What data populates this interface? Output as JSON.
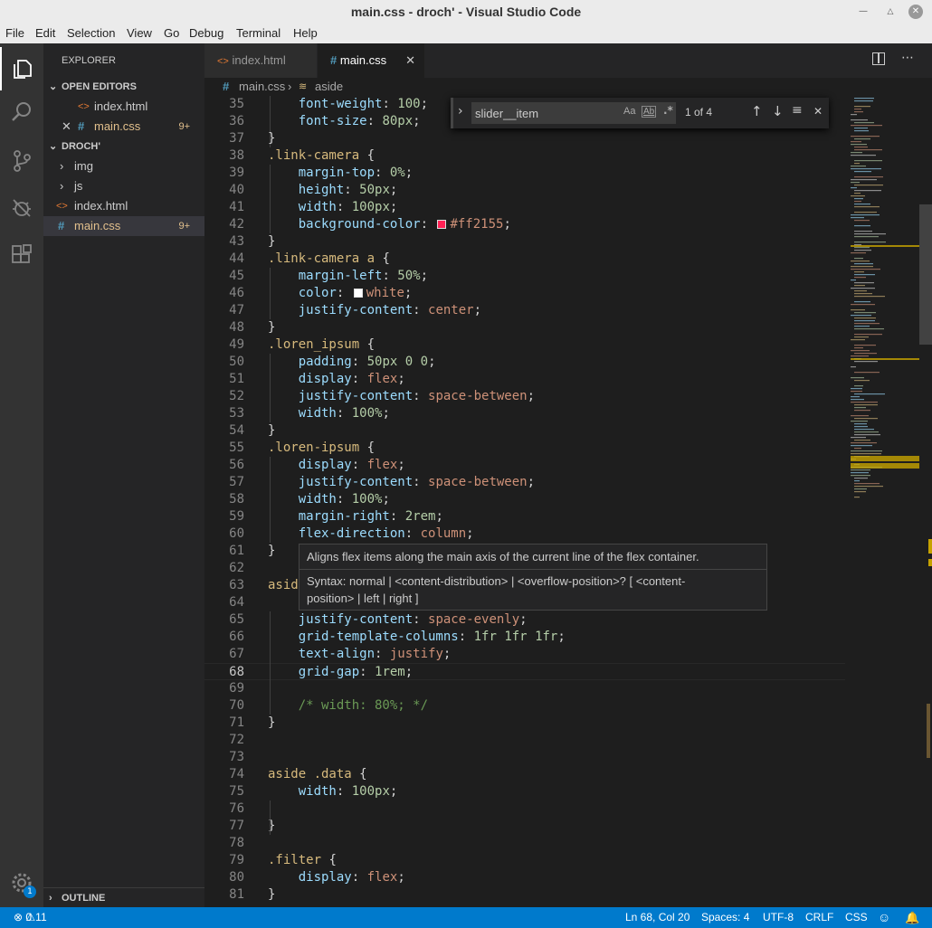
{
  "window": {
    "title": "main.css - droch' - Visual Studio Code"
  },
  "menu": [
    "File",
    "Edit",
    "Selection",
    "View",
    "Go",
    "Debug",
    "Terminal",
    "Help"
  ],
  "sidebar": {
    "title": "EXPLORER",
    "open_editors_label": "OPEN EDITORS",
    "open_editors": [
      {
        "name": "index.html",
        "icon": "html-file-icon"
      },
      {
        "name": "main.css",
        "icon": "css-file-icon",
        "badge": "9+"
      }
    ],
    "folder_label": "DROCH'",
    "tree": [
      {
        "name": "img",
        "type": "folder"
      },
      {
        "name": "js",
        "type": "folder"
      },
      {
        "name": "index.html",
        "type": "html"
      },
      {
        "name": "main.css",
        "type": "css",
        "badge": "9+"
      }
    ],
    "outline_label": "OUTLINE"
  },
  "settings_badge": "1",
  "tabs": [
    {
      "label": "index.html",
      "active": false
    },
    {
      "label": "main.css",
      "active": true
    }
  ],
  "breadcrumb": {
    "file": "main.css",
    "symbol": "aside"
  },
  "find": {
    "value": "slider__item",
    "match_case": "Aa",
    "whole_word": "Ab",
    "regex": ".*",
    "result": "1 of 4"
  },
  "hover": {
    "description": "Aligns flex items along the main axis of the current line of the flex container.",
    "syntax_line1": "Syntax: normal | <content-distribution> | <overflow-position>? [ <content-",
    "syntax_line2": "position> | left | right ]"
  },
  "code_lines": [
    {
      "n": "35",
      "t": "    font-weight: 100;"
    },
    {
      "n": "36",
      "t": "    font-size: 80px;"
    },
    {
      "n": "37",
      "t": "}"
    },
    {
      "n": "38",
      "t": ".link-camera {"
    },
    {
      "n": "39",
      "t": "    margin-top: 0%;"
    },
    {
      "n": "40",
      "t": "    height: 50px;"
    },
    {
      "n": "41",
      "t": "    width: 100px;"
    },
    {
      "n": "42",
      "t": "    background-color: #ff2155;"
    },
    {
      "n": "43",
      "t": "}"
    },
    {
      "n": "44",
      "t": ".link-camera a {"
    },
    {
      "n": "45",
      "t": "    margin-left: 50%;"
    },
    {
      "n": "46",
      "t": "    color: white;"
    },
    {
      "n": "47",
      "t": "    justify-content: center;"
    },
    {
      "n": "48",
      "t": "}"
    },
    {
      "n": "49",
      "t": ".loren_ipsum {"
    },
    {
      "n": "50",
      "t": "    padding: 50px 0 0;"
    },
    {
      "n": "51",
      "t": "    display: flex;"
    },
    {
      "n": "52",
      "t": "    justify-content: space-between;"
    },
    {
      "n": "53",
      "t": "    width: 100%;"
    },
    {
      "n": "54",
      "t": "}"
    },
    {
      "n": "55",
      "t": ".loren-ipsum {"
    },
    {
      "n": "56",
      "t": "    display: flex;"
    },
    {
      "n": "57",
      "t": "    justify-content: space-between;"
    },
    {
      "n": "58",
      "t": "    width: 100%;"
    },
    {
      "n": "59",
      "t": "    margin-right: 2rem;"
    },
    {
      "n": "60",
      "t": "    flex-direction: column;"
    },
    {
      "n": "61",
      "t": "}"
    },
    {
      "n": "62",
      "t": ""
    },
    {
      "n": "63",
      "t": "aside"
    },
    {
      "n": "64",
      "t": ""
    },
    {
      "n": "65",
      "t": "    justify-content: space-evenly;"
    },
    {
      "n": "66",
      "t": "    grid-template-columns: 1fr 1fr 1fr;"
    },
    {
      "n": "67",
      "t": "    text-align: justify;"
    },
    {
      "n": "68",
      "t": "    grid-gap: 1rem;"
    },
    {
      "n": "69",
      "t": ""
    },
    {
      "n": "70",
      "t": "    /* width: 80%; */"
    },
    {
      "n": "71",
      "t": "}"
    },
    {
      "n": "72",
      "t": ""
    },
    {
      "n": "73",
      "t": ""
    },
    {
      "n": "74",
      "t": "aside .data {"
    },
    {
      "n": "75",
      "t": "    width: 100px;"
    },
    {
      "n": "76",
      "t": ""
    },
    {
      "n": "77",
      "t": "}"
    },
    {
      "n": "78",
      "t": ""
    },
    {
      "n": "79",
      "t": ".filter {"
    },
    {
      "n": "80",
      "t": "    display: flex;"
    },
    {
      "n": "81",
      "t": "}"
    }
  ],
  "colors": {
    "swatch_pink": "#ff2155",
    "swatch_white": "#ffffff",
    "statusbar": "#007acc"
  },
  "status": {
    "errors": "0",
    "warnings": "11",
    "position": "Ln 68, Col 20",
    "spaces": "Spaces: 4",
    "encoding": "UTF-8",
    "eol": "CRLF",
    "language": "CSS"
  }
}
